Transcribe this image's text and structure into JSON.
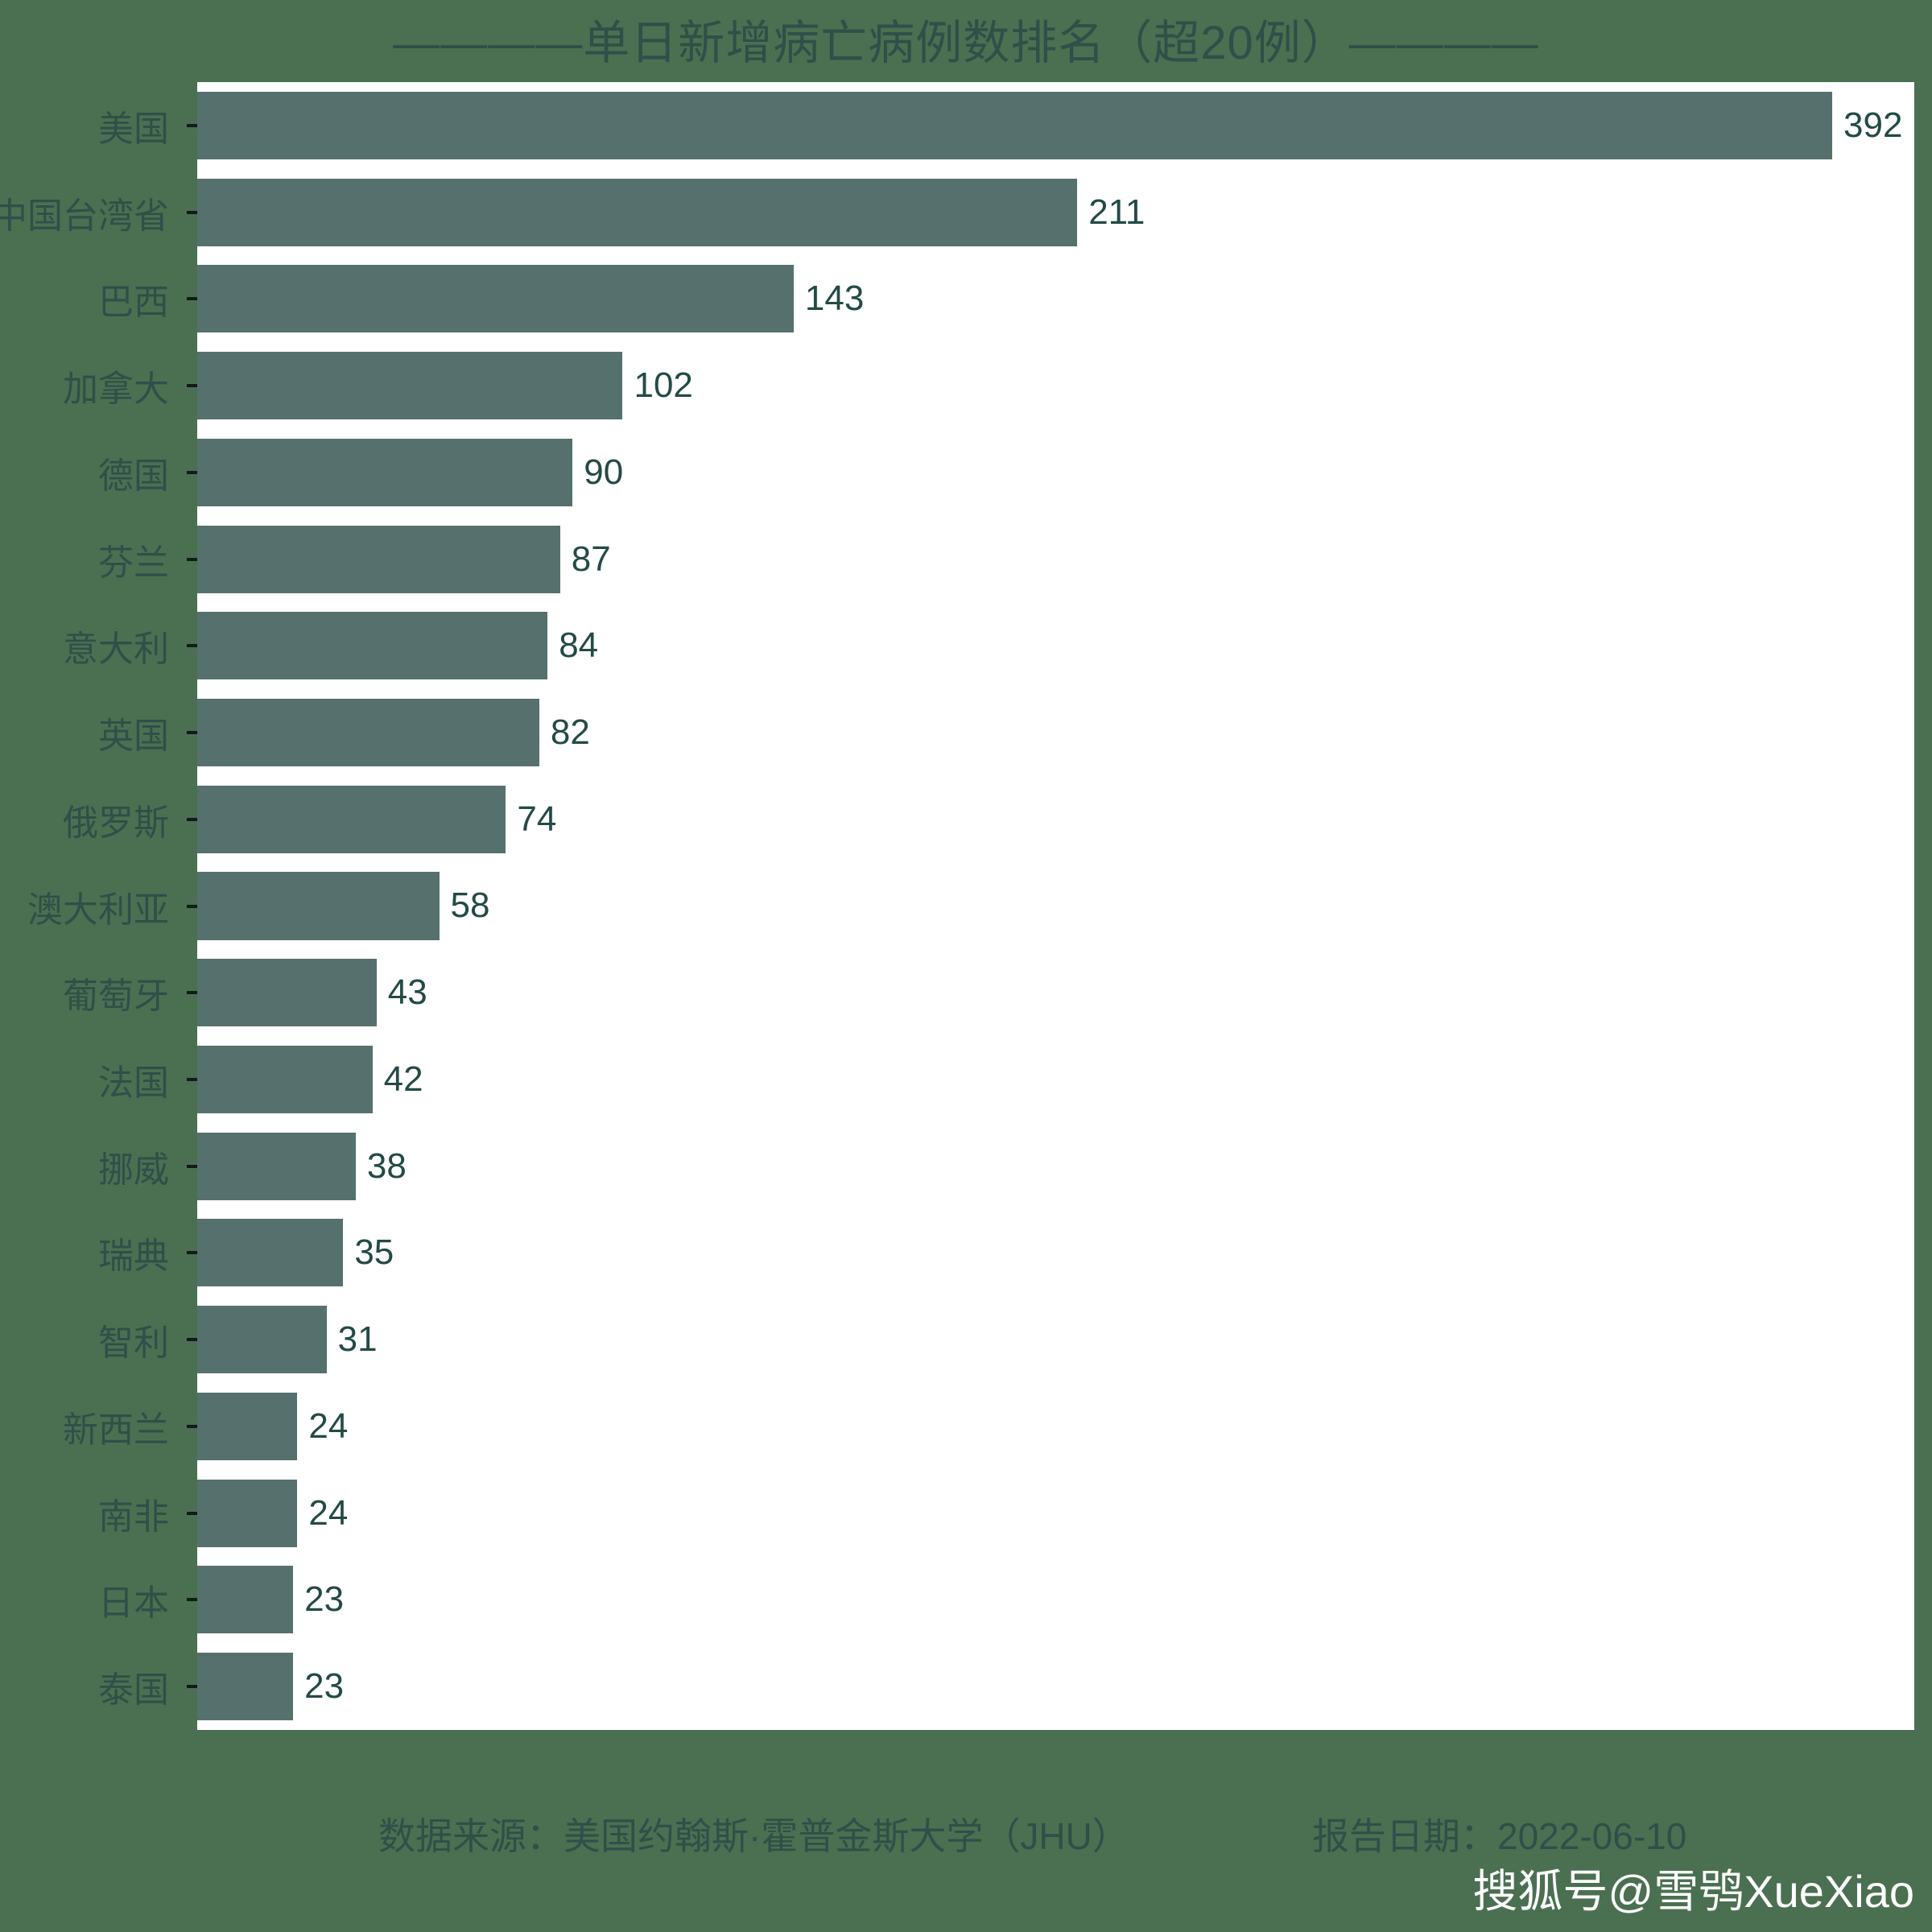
{
  "chart_data": {
    "type": "bar",
    "orientation": "horizontal",
    "title": "————单日新增病亡病例数排名（超20例）————",
    "xlabel": "",
    "ylabel": "",
    "grid": false,
    "legend": null,
    "xlim": [
      0,
      410
    ],
    "categories": [
      "美国",
      "中国台湾省",
      "巴西",
      "加拿大",
      "德国",
      "芬兰",
      "意大利",
      "英国",
      "俄罗斯",
      "澳大利亚",
      "葡萄牙",
      "法国",
      "挪威",
      "瑞典",
      "智利",
      "新西兰",
      "南非",
      "日本",
      "泰国"
    ],
    "values": [
      392,
      211,
      143,
      102,
      90,
      87,
      84,
      82,
      74,
      58,
      43,
      42,
      38,
      35,
      31,
      24,
      24,
      23,
      23
    ],
    "data_labels": [
      "392",
      "211",
      "143",
      "102",
      "90",
      "87",
      "84",
      "82",
      "74",
      "58",
      "43",
      "42",
      "38",
      "35",
      "31",
      "24",
      "24",
      "23",
      "23"
    ],
    "colors": {
      "background": "#4a7051",
      "plot_background": "#ffffff",
      "bar": "#56706d",
      "value_label": "#234a46",
      "axis_label": "#2f4f49",
      "title": "#2f4f49",
      "watermark": "#ffffff"
    }
  },
  "footer": {
    "source": "数据来源：美国约翰斯·霍普金斯大学（JHU）",
    "report_date": "报告日期：2022-06-10"
  },
  "watermark": {
    "text": "搜狐号@雪鸮XueXiao"
  }
}
